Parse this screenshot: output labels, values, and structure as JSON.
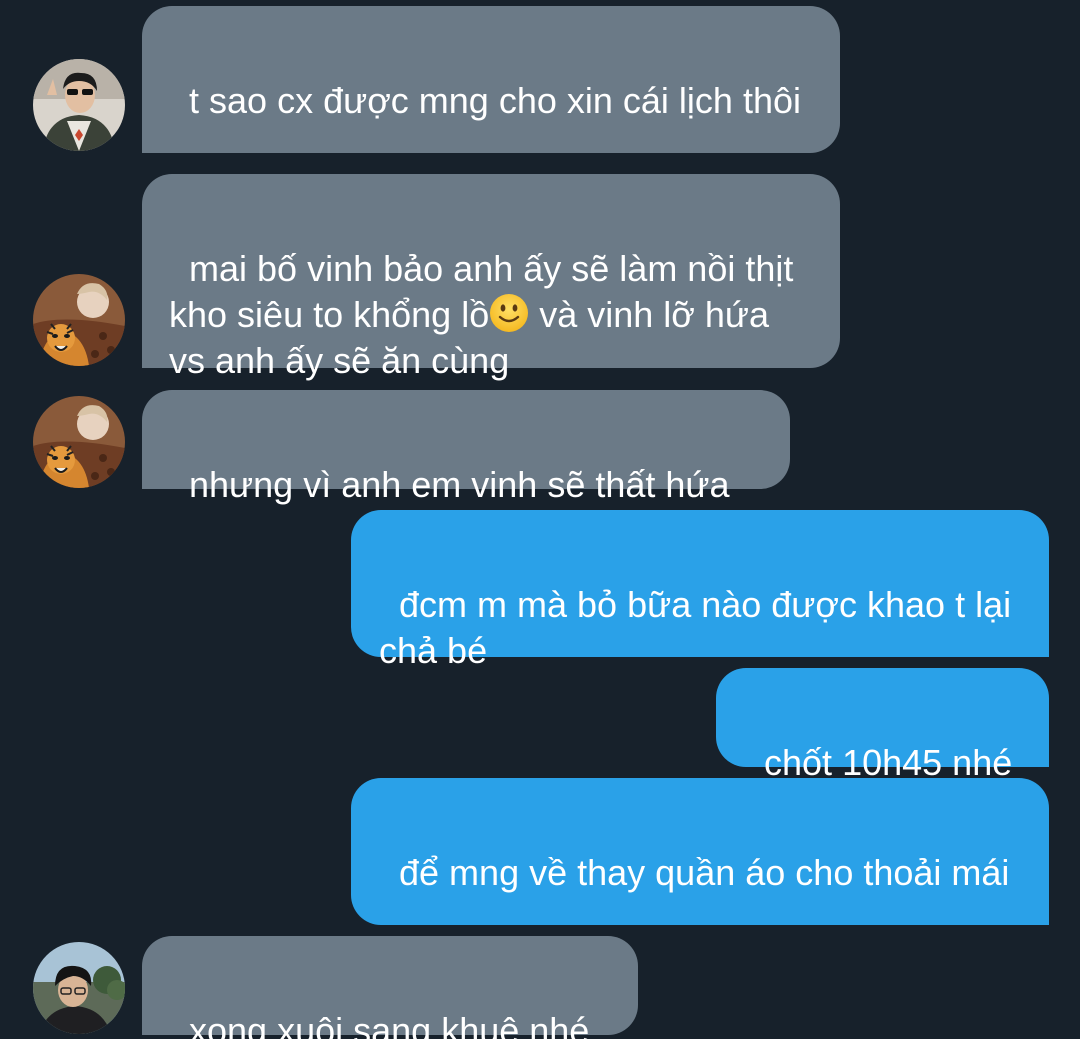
{
  "messages": [
    {
      "text": "t sao cx được mng cho xin cái lịch thôi",
      "avatar": "man-sunglasses-avatar"
    },
    {
      "text_before": "mai bố vinh bảo anh ấy sẽ làm nồi thịt kho siêu to khổng lồ",
      "emoji": "slightly-smiling-face",
      "text_after": " và vinh lỡ hứa vs anh ấy sẽ ăn cùng",
      "avatar": "tiger-blanket-avatar"
    },
    {
      "text": "nhưng vì anh em vinh sẽ thất hứa",
      "avatar": "tiger-blanket-avatar"
    },
    {
      "text": "đcm m mà bỏ bữa nào được khao t lại chả bé"
    },
    {
      "text": "chốt 10h45 nhé"
    },
    {
      "text": "để mng về thay quần áo cho thoải mái"
    },
    {
      "text": "xong xuôi sang khuê nhé",
      "avatar": "man-outdoor-avatar"
    }
  ],
  "colors": {
    "background": "#17212b",
    "incoming_bubble": "#6b7a87",
    "outgoing_bubble": "#2aa1e8",
    "text": "#ffffff"
  }
}
